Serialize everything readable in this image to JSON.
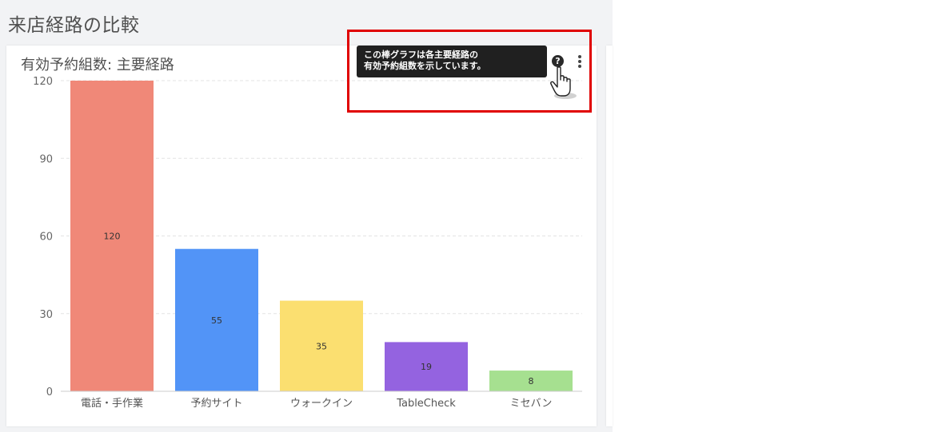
{
  "page": {
    "title": "来店経路の比較"
  },
  "card": {
    "title": "有効予約組数: 主要経路",
    "help_icon": "question-circle-icon",
    "more_icon": "vertical-ellipsis-icon"
  },
  "tooltip": {
    "line1": "この棒グラフは各主要経路の",
    "line2": "有効予約組数を示しています。"
  },
  "colors": {
    "highlight": "#e00000",
    "tooltip_bg": "#202020"
  },
  "chart_data": {
    "type": "bar",
    "categories": [
      "電話・手作業",
      "予約サイト",
      "ウォークイン",
      "TableCheck",
      "ミセバン"
    ],
    "values": [
      120,
      55,
      35,
      19,
      8
    ],
    "colors": [
      "#f08878",
      "#5294f7",
      "#fbdf70",
      "#9463e0",
      "#a6e090"
    ],
    "yticks": [
      0,
      30,
      60,
      90,
      120
    ],
    "ylim": [
      0,
      120
    ],
    "grid": true,
    "data_labels": true
  }
}
